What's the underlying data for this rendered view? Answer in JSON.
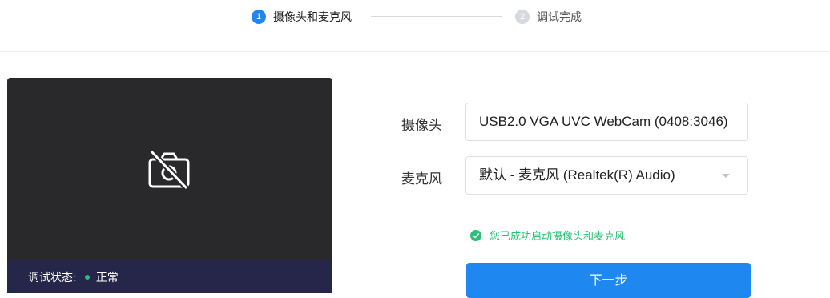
{
  "steps": [
    {
      "number": "1",
      "label": "摄像头和麦克风",
      "state": "active"
    },
    {
      "number": "2",
      "label": "调试完成",
      "state": "inactive"
    }
  ],
  "preview": {
    "camera_icon": "camera-off-icon",
    "status_label": "调试状态:",
    "status_value": "正常"
  },
  "form": {
    "camera_label": "摄像头",
    "camera_value": "USB2.0 VGA UVC WebCam (0408:3046)",
    "mic_label": "麦克风",
    "mic_value": "默认 - 麦克风 (Realtek(R) Audio)"
  },
  "success_message": "您已成功启动摄像头和麦克风",
  "next_button_label": "下一步",
  "colors": {
    "accent": "#1e88f0",
    "success": "#2cbf75",
    "preview_bg": "#29292c",
    "status_bar_bg": "#26264a"
  }
}
